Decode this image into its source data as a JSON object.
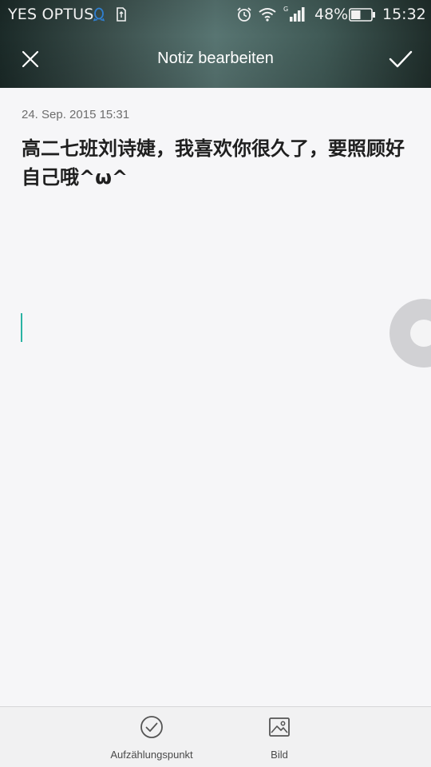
{
  "status_bar": {
    "carrier": "YES OPTUS",
    "battery_percent": "48%",
    "battery_level": 0.48,
    "time": "15:32",
    "icons": [
      "qq-icon",
      "sim-card-icon",
      "alarm-icon",
      "wifi-icon",
      "signal-icon",
      "battery-icon"
    ]
  },
  "title_bar": {
    "title": "Notiz bearbeiten",
    "left_icon": "close-icon",
    "right_icon": "checkmark-icon"
  },
  "note": {
    "date": "24. Sep. 2015 15:31",
    "text": "高二七班刘诗婕，我喜欢你很久了，要照顾好自己哦^ω^"
  },
  "toolbar": {
    "items": [
      {
        "label": "Aufzählungspunkt",
        "icon": "check-circle-icon"
      },
      {
        "label": "Bild",
        "icon": "image-icon"
      }
    ]
  },
  "colors": {
    "cursor": "#2ab3a3",
    "background": "#f6f6f8"
  }
}
